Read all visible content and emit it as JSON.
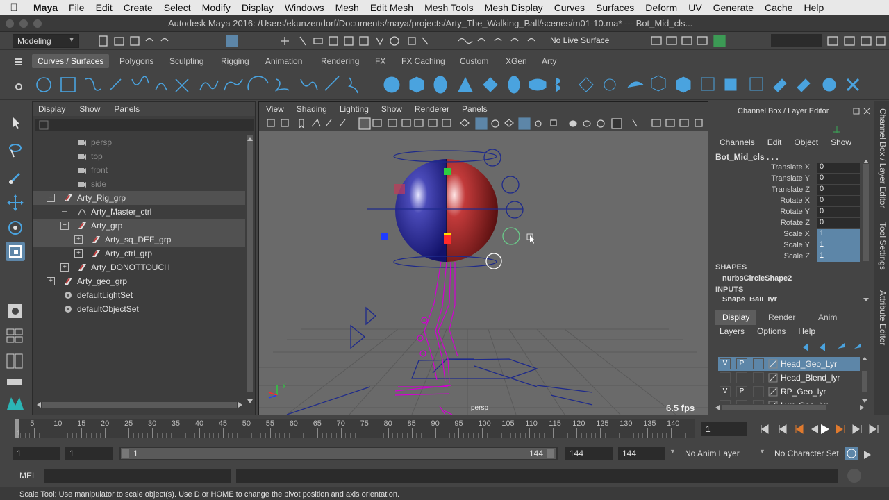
{
  "menubar": {
    "app": "Maya",
    "items": [
      "File",
      "Edit",
      "Create",
      "Select",
      "Modify",
      "Display",
      "Windows",
      "Mesh",
      "Edit Mesh",
      "Mesh Tools",
      "Mesh Display",
      "Curves",
      "Surfaces",
      "Deform",
      "UV",
      "Generate",
      "Cache",
      "Help"
    ]
  },
  "window": {
    "title": "Autodesk Maya 2016: /Users/ekunzendorf/Documents/maya/projects/Arty_The_Walking_Ball/scenes/m01-10.ma*   ---   Bot_Mid_cls..."
  },
  "statusline": {
    "menuset": "Modeling",
    "live_surface": "No Live Surface"
  },
  "shelf": {
    "tabs": [
      "Curves / Surfaces",
      "Polygons",
      "Sculpting",
      "Rigging",
      "Animation",
      "Rendering",
      "FX",
      "FX Caching",
      "Custom",
      "XGen",
      "Arty"
    ],
    "active_tab": "Curves / Surfaces"
  },
  "outliner": {
    "menu": [
      "Display",
      "Show",
      "Panels"
    ],
    "rows": [
      {
        "label": "persp",
        "indent": 1,
        "icon": "camera-icon",
        "dim": true
      },
      {
        "label": "top",
        "indent": 1,
        "icon": "camera-icon",
        "dim": true
      },
      {
        "label": "front",
        "indent": 1,
        "icon": "camera-icon",
        "dim": true
      },
      {
        "label": "side",
        "indent": 1,
        "icon": "camera-icon",
        "dim": true
      },
      {
        "label": "Arty_Rig_grp",
        "indent": 0,
        "icon": "transform-icon",
        "expander": "−",
        "sel": true
      },
      {
        "label": "Arty_Master_ctrl",
        "indent": 1,
        "icon": "curve-icon"
      },
      {
        "label": "Arty_grp",
        "indent": 1,
        "icon": "transform-icon",
        "expander": "−",
        "sel": true
      },
      {
        "label": "Arty_sq_DEF_grp",
        "indent": 2,
        "icon": "transform-icon",
        "expander": "+",
        "sel": true
      },
      {
        "label": "Arty_ctrl_grp",
        "indent": 2,
        "icon": "transform-icon",
        "expander": "+"
      },
      {
        "label": "Arty_DONOTTOUCH",
        "indent": 1,
        "icon": "transform-icon",
        "expander": "+"
      },
      {
        "label": "Arty_geo_grp",
        "indent": 0,
        "icon": "transform-icon",
        "expander": "+"
      },
      {
        "label": "defaultLightSet",
        "indent": 0,
        "icon": "set-icon"
      },
      {
        "label": "defaultObjectSet",
        "indent": 0,
        "icon": "set-icon"
      }
    ]
  },
  "viewport": {
    "menu": [
      "View",
      "Shading",
      "Lighting",
      "Show",
      "Renderer",
      "Panels"
    ],
    "camera": "persp",
    "fps": "6.5 fps"
  },
  "channelbox": {
    "header": "Channel Box / Layer Editor",
    "menu": [
      "Channels",
      "Edit",
      "Object",
      "Show"
    ],
    "object": "Bot_Mid_cls . . .",
    "channels": [
      {
        "name": "Translate X",
        "value": "0"
      },
      {
        "name": "Translate Y",
        "value": "0"
      },
      {
        "name": "Translate Z",
        "value": "0"
      },
      {
        "name": "Rotate X",
        "value": "0"
      },
      {
        "name": "Rotate Y",
        "value": "0"
      },
      {
        "name": "Rotate Z",
        "value": "0"
      },
      {
        "name": "Scale X",
        "value": "1",
        "hl": true
      },
      {
        "name": "Scale Y",
        "value": "1",
        "hl": true
      },
      {
        "name": "Scale Z",
        "value": "1",
        "hl": true
      }
    ],
    "shapes_label": "SHAPES",
    "shape": "nurbsCircleShape2",
    "inputs_label": "INPUTS",
    "input": "Shape_Ball_lyr"
  },
  "layers": {
    "tabs": [
      "Display",
      "Render",
      "Anim"
    ],
    "menu": [
      "Layers",
      "Options",
      "Help"
    ],
    "rows": [
      {
        "v": "V",
        "p": "P",
        "name": "Head_Geo_Lyr",
        "sel": true
      },
      {
        "v": "",
        "p": "",
        "name": "Head_Blend_lyr"
      },
      {
        "v": "V",
        "p": "P",
        "name": "RP_Geo_lyr"
      },
      {
        "v": "",
        "p": "",
        "name": "Lwr_Geo_lyr"
      }
    ]
  },
  "rtabs": [
    "Channel Box / Layer Editor",
    "Tool Settings",
    "Attribute Editor"
  ],
  "timeslider": {
    "ticks": [
      "5",
      "10",
      "15",
      "20",
      "25",
      "30",
      "35",
      "40",
      "45",
      "50",
      "55",
      "60",
      "65",
      "70",
      "75",
      "80",
      "85",
      "90",
      "95",
      "100",
      "105",
      "110",
      "115",
      "120",
      "125",
      "130",
      "135",
      "140"
    ],
    "start_label": "1",
    "current_frame": "1"
  },
  "rangeslider": {
    "start": "1",
    "anim_start": "1",
    "range_start": "1",
    "range_end": "144",
    "end": "144",
    "anim_end": "144",
    "anim_layer": "No Anim Layer",
    "character_set": "No Character Set"
  },
  "cmdline": {
    "label": "MEL"
  },
  "helpline": {
    "text": "Scale Tool: Use manipulator to scale object(s). Use D or HOME to change the pivot position and axis orientation."
  }
}
